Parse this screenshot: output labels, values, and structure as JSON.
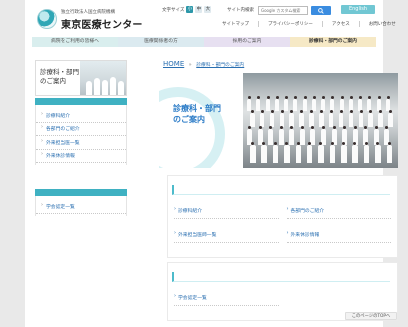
{
  "header": {
    "org_line": "独立行政法人国立病院機構",
    "site_name": "東京医療センター",
    "font_size_label": "文字サイズ",
    "font_small": "小",
    "font_medium": "中",
    "font_large": "大",
    "search_label": "サイト内検索",
    "search_placeholder": "Google カスタム検索",
    "english_label": "English",
    "util_nav": [
      "サイトマップ",
      "プライバシーポリシー",
      "アクセス",
      "お問い合わせ"
    ]
  },
  "global_nav": [
    "病院をご利用の皆様へ",
    "医療関係者の方",
    "採用のご案内",
    "診療科・部門のご案内"
  ],
  "sidebar": {
    "title": "診療科・部門のご案内",
    "items": [
      "診療科紹介",
      "各部門のご紹介",
      "外来担当医一覧",
      "外来休診情報"
    ],
    "items2": [
      "学会認定一覧"
    ]
  },
  "breadcrumb": {
    "home": "HOME",
    "separator": "»",
    "current": "診療科・部門のご案内"
  },
  "hero": {
    "title": "診療科・部門のご案内"
  },
  "main": {
    "links": [
      "診療科紹介",
      "各部門のご紹介",
      "外来担当医師一覧",
      "外来休診情報"
    ],
    "links2": [
      "学会認定一覧"
    ]
  },
  "pagetop": "このページのTOPへ",
  "colors": {
    "accent": "#3fb1c2",
    "link": "#2a6fb1"
  }
}
